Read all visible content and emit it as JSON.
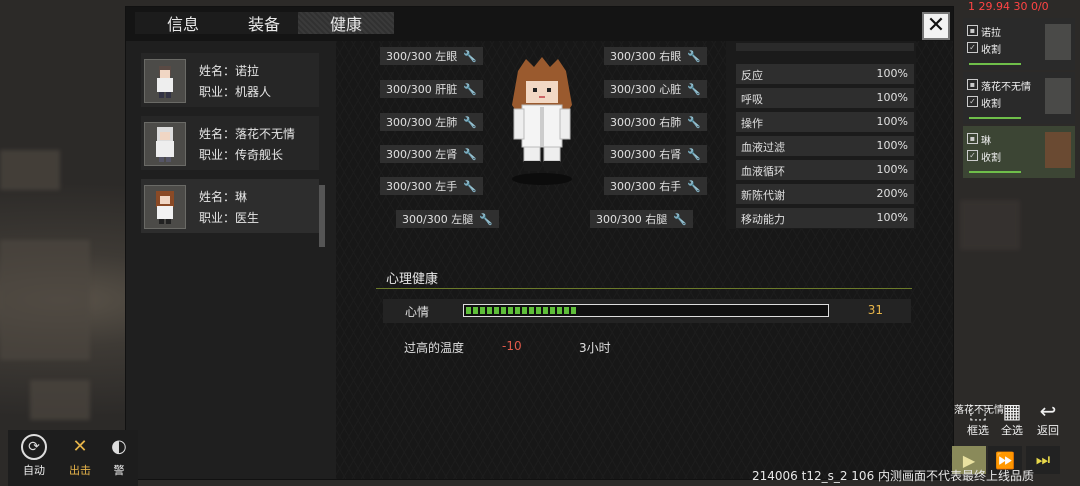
{
  "tabs": [
    {
      "label": "信息"
    },
    {
      "label": "装备"
    },
    {
      "label": "健康"
    }
  ],
  "characters": [
    {
      "name": "姓名：诺拉",
      "job": "职业：机器人"
    },
    {
      "name": "姓名：落花不无情",
      "job": "职业：传奇舰长"
    },
    {
      "name": "姓名：琳",
      "job": "职业：医生"
    }
  ],
  "organs": {
    "left": [
      "300/300 左眼",
      "300/300 肝脏",
      "300/300 左肺",
      "300/300 左肾",
      "300/300 左手",
      "300/300 左腿"
    ],
    "right": [
      "300/300 右眼",
      "300/300 心脏",
      "300/300 右肺",
      "300/300 右肾",
      "300/300 右手",
      "300/300 右腿"
    ]
  },
  "stats": [
    {
      "name": "反应",
      "value": "100%"
    },
    {
      "name": "呼吸",
      "value": "100%"
    },
    {
      "name": "操作",
      "value": "100%"
    },
    {
      "name": "血液过滤",
      "value": "100%"
    },
    {
      "name": "血液循环",
      "value": "100%"
    },
    {
      "name": "新陈代谢",
      "value": "200%"
    },
    {
      "name": "移动能力",
      "value": "100%"
    }
  ],
  "mental": {
    "title": "心理健康",
    "mood_label": "心情",
    "mood_value": "31",
    "mood_fraction": 0.31
  },
  "thoughts": [
    {
      "name": "过高的温度",
      "effect": "-10",
      "duration": "3小时"
    }
  ],
  "party": [
    {
      "name": "诺拉",
      "task": "收割"
    },
    {
      "name": "落花不无情",
      "task": "收割"
    },
    {
      "name": "琳",
      "task": "收割"
    }
  ],
  "top_right": "1  29.94 30 0/0",
  "bottom_left": [
    {
      "label": "自动"
    },
    {
      "label": "出击"
    },
    {
      "label": "警"
    }
  ],
  "bottom_right": [
    {
      "label": "框选"
    },
    {
      "label": "全选"
    },
    {
      "label": "返回"
    }
  ],
  "floating_label": "落花不无情",
  "footer": "214006 t12_s_2 106  内测画面不代表最终上线品质",
  "colors": {
    "mood_fill": "#5fbe3a",
    "mood_value": "#e6b44a",
    "thought_negative": "#e05a4a",
    "party_selected": "#3c4534"
  }
}
